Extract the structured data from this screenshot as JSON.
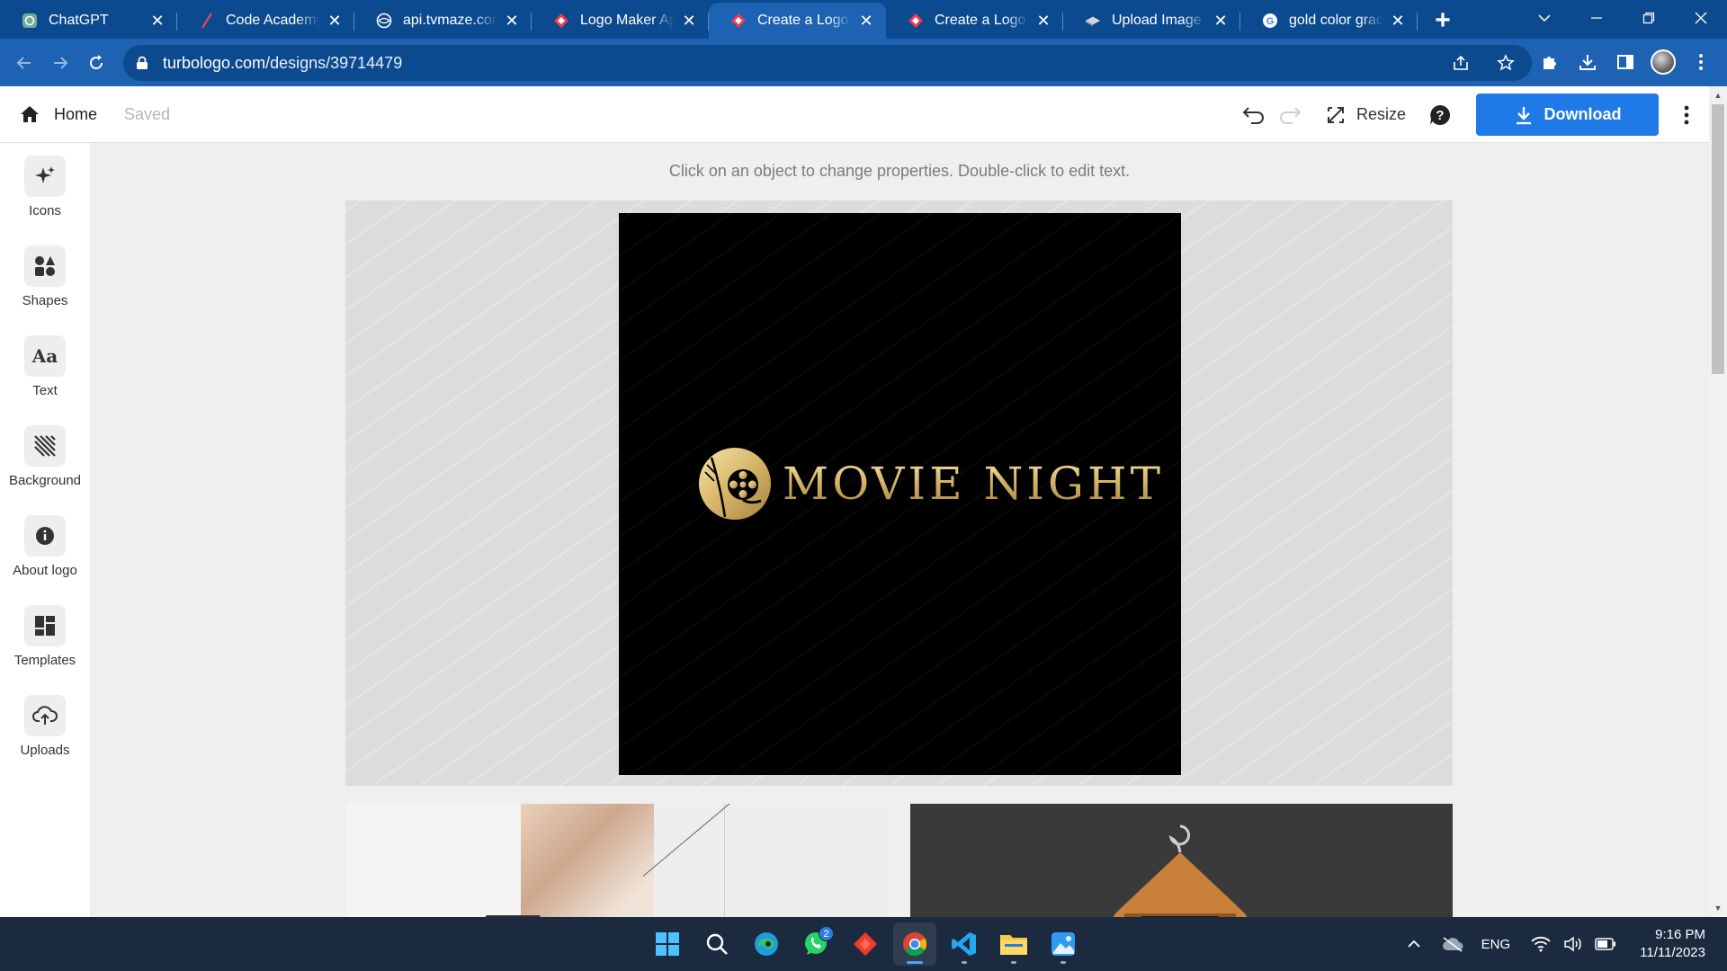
{
  "browser": {
    "tabs": [
      {
        "title": "ChatGPT",
        "favicon": "chatgpt-icon",
        "active": false
      },
      {
        "title": "Code Academy Use",
        "favicon": "pen-icon",
        "active": false
      },
      {
        "title": "api.tvmaze.com/",
        "favicon": "globe-icon",
        "active": false
      },
      {
        "title": "Logo Maker App",
        "favicon": "turbologo-icon",
        "active": false
      },
      {
        "title": "Create a Logo Online",
        "favicon": "turbologo-icon",
        "active": true
      },
      {
        "title": "Create a Logo Online",
        "favicon": "turbologo-icon",
        "active": false
      },
      {
        "title": "Upload Image – ",
        "favicon": "upload-icon",
        "active": false
      },
      {
        "title": "gold color gradient",
        "favicon": "google-icon",
        "active": false
      }
    ],
    "url_host": "turbologo.com",
    "url_path": "/designs/39714479"
  },
  "header": {
    "home_label": "Home",
    "status": "Saved",
    "resize_label": "Resize",
    "download_label": "Download"
  },
  "sidebar": {
    "items": [
      {
        "label": "Icons",
        "icon": "sparkle-icon"
      },
      {
        "label": "Shapes",
        "icon": "shapes-icon"
      },
      {
        "label": "Text",
        "icon": "text-icon"
      },
      {
        "label": "Background",
        "icon": "background-icon"
      },
      {
        "label": "About logo",
        "icon": "info-icon"
      },
      {
        "label": "Templates",
        "icon": "templates-icon"
      },
      {
        "label": "Uploads",
        "icon": "upload-cloud-icon"
      }
    ]
  },
  "workspace": {
    "hint": "Click on an object to change properties. Double-click to edit text.",
    "logo_text": "MOVIE NIGHT",
    "watermark": "turbologo"
  },
  "colors": {
    "browser_frame": "#0b4a8f",
    "browser_toolbar": "#1d62b3",
    "download_button": "#1f7ae8",
    "canvas_background": "#000000",
    "logo_gold_light": "#f6e4a8",
    "logo_gold_dark": "#a7823d",
    "taskbar": "#1b2a3e"
  },
  "taskbar": {
    "apps": [
      {
        "name": "windows-start-icon"
      },
      {
        "name": "search-icon"
      },
      {
        "name": "edge-icon"
      },
      {
        "name": "whatsapp-icon",
        "badge": "2"
      },
      {
        "name": "anydesk-icon"
      },
      {
        "name": "chrome-icon",
        "active": true
      },
      {
        "name": "vscode-icon"
      },
      {
        "name": "file-explorer-icon"
      },
      {
        "name": "photos-icon"
      }
    ],
    "language": "ENG",
    "time": "9:16 PM",
    "date": "11/11/2023"
  }
}
